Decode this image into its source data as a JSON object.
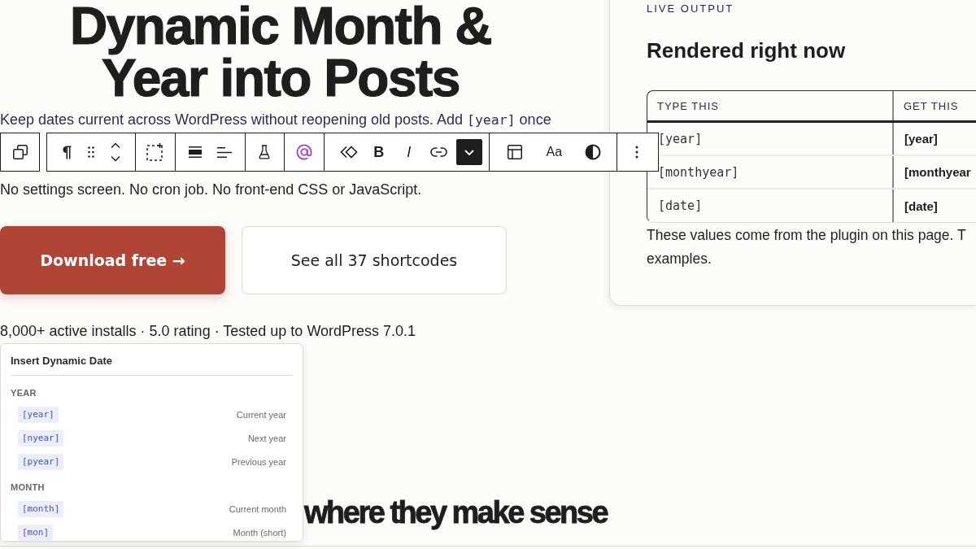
{
  "hero": {
    "title": "Dynamic Month & Year into Posts",
    "intro": [
      {
        "kind": "text",
        "text": "Keep dates current across WordPress without reopening old posts. Add "
      },
      {
        "kind": "code",
        "text": "[year]"
      },
      {
        "kind": "text",
        "text": " once"
      }
    ],
    "note": "No settings screen. No cron job. No front-end CSS or JavaScript."
  },
  "buttons": [
    {
      "kind": "primary",
      "label": "Download free →"
    },
    {
      "kind": "secondary",
      "label": "See all 37 shortcodes"
    }
  ],
  "stats": "8,000+ active installs · 5.0 rating · Tested up to WordPress 7.0.1",
  "section_heading": "where they make sense",
  "block_toolbar": {
    "bold_label": "B",
    "italic_label": "I",
    "typography_label": "Aa",
    "more_formatting_open": true
  },
  "live_output": {
    "eyebrow": "LIVE OUTPUT",
    "title": "Rendered right now",
    "table": {
      "columns": [
        "TYPE THIS",
        "GET THIS"
      ],
      "rows": [
        [
          "[year]",
          "[year]"
        ],
        [
          "[monthyear]",
          "[monthyear"
        ],
        [
          "[date]",
          "[date]"
        ]
      ]
    },
    "note_lines": [
      "These values come from the plugin on this page. T",
      "examples."
    ]
  },
  "date_menu": {
    "title": "Insert Dynamic Date",
    "groups": [
      {
        "label": "YEAR",
        "items": [
          {
            "code": "[year]",
            "description": "Current year"
          },
          {
            "code": "[nyear]",
            "description": "Next year"
          },
          {
            "code": "[pyear]",
            "description": "Previous year"
          }
        ]
      },
      {
        "label": "MONTH",
        "items": [
          {
            "code": "[month]",
            "description": "Current month"
          },
          {
            "code": "[mon]",
            "description": "Month (short)"
          }
        ]
      }
    ]
  }
}
